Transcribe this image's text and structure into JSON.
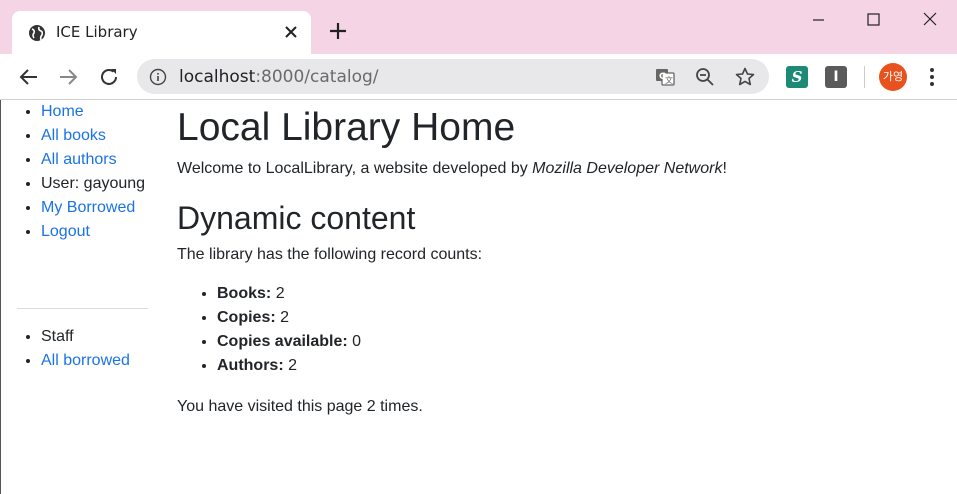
{
  "browser": {
    "tab_title": "ICE Library",
    "url_host": "localhost",
    "url_rest": ":8000/catalog/",
    "avatar_text": "가영",
    "extensions": [
      "S",
      "I"
    ]
  },
  "sidebar": {
    "items": [
      {
        "label": "Home",
        "link": true
      },
      {
        "label": "All books",
        "link": true
      },
      {
        "label": "All authors",
        "link": true
      },
      {
        "label": "User: gayoung",
        "link": false
      },
      {
        "label": "My Borrowed",
        "link": true
      },
      {
        "label": "Logout",
        "link": true
      }
    ],
    "staff_items": [
      {
        "label": "Staff",
        "link": false
      },
      {
        "label": "All borrowed",
        "link": true
      }
    ]
  },
  "main": {
    "title": "Local Library Home",
    "welcome_prefix": "Welcome to LocalLibrary, a website developed by ",
    "welcome_emph": "Mozilla Developer Network",
    "welcome_suffix": "!",
    "section_title": "Dynamic content",
    "counts_intro": "The library has the following record counts:",
    "counts": [
      {
        "label": "Books:",
        "value": "2"
      },
      {
        "label": "Copies:",
        "value": "2"
      },
      {
        "label": "Copies available:",
        "value": "0"
      },
      {
        "label": "Authors:",
        "value": "2"
      }
    ],
    "visits": "You have visited this page 2 times."
  },
  "colors": {
    "titlebar": "#f5d4e6",
    "link": "#1a73e8",
    "avatar": "#e8521e"
  }
}
